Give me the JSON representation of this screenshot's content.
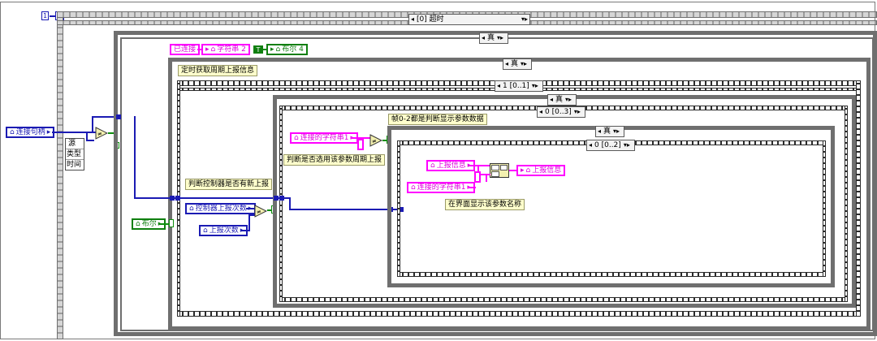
{
  "loop": {
    "index_label": "1",
    "stop_label": "☒"
  },
  "event_selector": {
    "label": "[0] 超时"
  },
  "outer_case": {
    "label": "真"
  },
  "connected_case": {
    "label": "真"
  },
  "sequence1": {
    "label": "1 [0..1]"
  },
  "inner_case1": {
    "label": "真"
  },
  "sequence2": {
    "label": "0 [0..3]"
  },
  "inner_case2": {
    "label": "真"
  },
  "sequence3": {
    "label": "0 [0..2]"
  },
  "event_data": {
    "items": [
      "源",
      "类型",
      "时间"
    ]
  },
  "terminals": {
    "conn_handle": "连接句柄",
    "connected": "已连接",
    "string2": "字符串 2",
    "bool_const": "T",
    "bool4": "布尔 4",
    "bool": "布尔",
    "ctrl_report_count": "控制器上报次数",
    "report_count": "上报次数",
    "conn_string1_a": "连接的字符串1",
    "report_info": "上报信息",
    "report_info_out": "上报信息",
    "conn_string1_b": "连接的字符串1"
  },
  "comments": {
    "periodic": "定时获取周期上报信息",
    "check_new": "判断控制器是否有新上报",
    "frame_note": "帧0-2都是判断显示参数数据",
    "check_period": "判断是否选用该参数周期上报",
    "display_name": "在界面显示该参数名称"
  },
  "colors": {
    "wire_int": "#1b1bb3",
    "wire_bool": "#0f8f0f",
    "wire_string": "#ff00ff",
    "comment_bg": "#ffffcc"
  }
}
